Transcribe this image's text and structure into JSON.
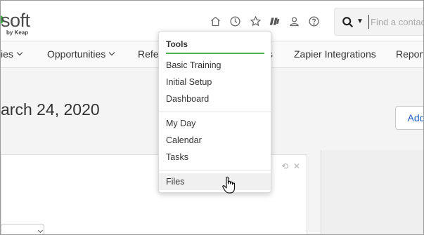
{
  "header": {
    "logo_text": "soft",
    "logo_sub": "by Keap",
    "icons": [
      "home-icon",
      "clock-icon",
      "star-icon",
      "zapier-icon",
      "user-icon",
      "help-icon"
    ],
    "search": {
      "placeholder": "Find a contact",
      "value": ""
    }
  },
  "nav": {
    "items": [
      {
        "label": "ies",
        "has_chevron": true
      },
      {
        "label": "Opportunities",
        "has_chevron": true
      },
      {
        "label": "Refe",
        "has_chevron": false
      },
      {
        "label": "s",
        "has_chevron": false
      },
      {
        "label": "Zapier Integrations",
        "has_chevron": false
      },
      {
        "label": "Report",
        "has_chevron": false
      }
    ]
  },
  "main": {
    "title": "arch 24, 2020",
    "add_button": "Add"
  },
  "menu": {
    "title": "Tools",
    "groups": [
      [
        "Basic Training",
        "Initial Setup",
        "Dashboard"
      ],
      [
        "My Day",
        "Calendar",
        "Tasks"
      ],
      [
        "Files"
      ]
    ],
    "hovered": "Files"
  },
  "colors": {
    "accent": "#4caf50",
    "link": "#1f5fc4",
    "logo_green": "#3cb043"
  }
}
